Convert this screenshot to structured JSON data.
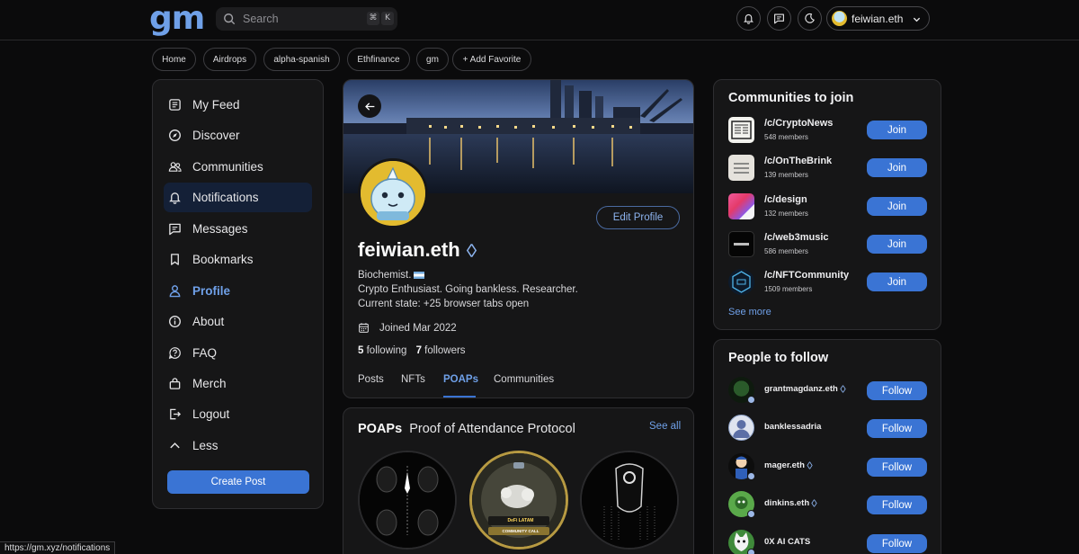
{
  "header": {
    "logo": "gm",
    "search_placeholder": "Search",
    "shortcut_keys": [
      "⌘",
      "K"
    ],
    "user_name": "feiwian.eth"
  },
  "favorites": [
    "Home",
    "Airdrops",
    "alpha-spanish",
    "Ethfinance",
    "gm",
    "+ Add Favorite"
  ],
  "sidebar": {
    "items": [
      {
        "label": "My Feed",
        "icon": "feed-icon"
      },
      {
        "label": "Discover",
        "icon": "compass-icon"
      },
      {
        "label": "Communities",
        "icon": "users-icon"
      },
      {
        "label": "Notifications",
        "icon": "bell-icon"
      },
      {
        "label": "Messages",
        "icon": "message-icon"
      },
      {
        "label": "Bookmarks",
        "icon": "bookmark-icon"
      },
      {
        "label": "Profile",
        "icon": "user-icon"
      },
      {
        "label": "About",
        "icon": "info-icon"
      },
      {
        "label": "FAQ",
        "icon": "question-icon"
      },
      {
        "label": "Merch",
        "icon": "bag-icon"
      },
      {
        "label": "Logout",
        "icon": "logout-icon"
      },
      {
        "label": "Less",
        "icon": "chevron-up-icon"
      }
    ],
    "create_post": "Create Post"
  },
  "profile": {
    "name": "feiwian.eth",
    "edit_label": "Edit Profile",
    "bio_line1": "Biochemist.",
    "bio_line2": "Crypto Enthusiast. Going bankless. Researcher.",
    "bio_line3": "Current state: +25 browser tabs open",
    "joined": "Joined Mar 2022",
    "following_count": "5",
    "following_label": "following",
    "followers_count": "7",
    "followers_label": "followers",
    "tabs": [
      "Posts",
      "NFTs",
      "POAPs",
      "Communities"
    ]
  },
  "poaps": {
    "title": "POAPs",
    "subtitle": "Proof of Attendance Protocol",
    "see_all": "See all",
    "badge_texts": [
      "DeFi LATAM",
      "COMMUNITY CALL"
    ]
  },
  "communities": {
    "title": "Communities to join",
    "items": [
      {
        "name": "/c/CryptoNews",
        "members": "548 members"
      },
      {
        "name": "/c/OnTheBrink",
        "members": "139 members"
      },
      {
        "name": "/c/design",
        "members": "132 members"
      },
      {
        "name": "/c/web3music",
        "members": "586 members"
      },
      {
        "name": "/c/NFTCommunity",
        "members": "1509 members"
      }
    ],
    "join_label": "Join",
    "see_more": "See more"
  },
  "people": {
    "title": "People to follow",
    "items": [
      {
        "name": "grantmagdanz.eth"
      },
      {
        "name": "banklessadria"
      },
      {
        "name": "mager.eth"
      },
      {
        "name": "dinkins.eth"
      },
      {
        "name": "0X AI CATS"
      }
    ],
    "follow_label": "Follow"
  },
  "status_url": "https://gm.xyz/notifications",
  "colors": {
    "accent": "#3a74d4",
    "link": "#6fa0e8",
    "active_nav_bg": "#142037",
    "panel": "#161617"
  }
}
